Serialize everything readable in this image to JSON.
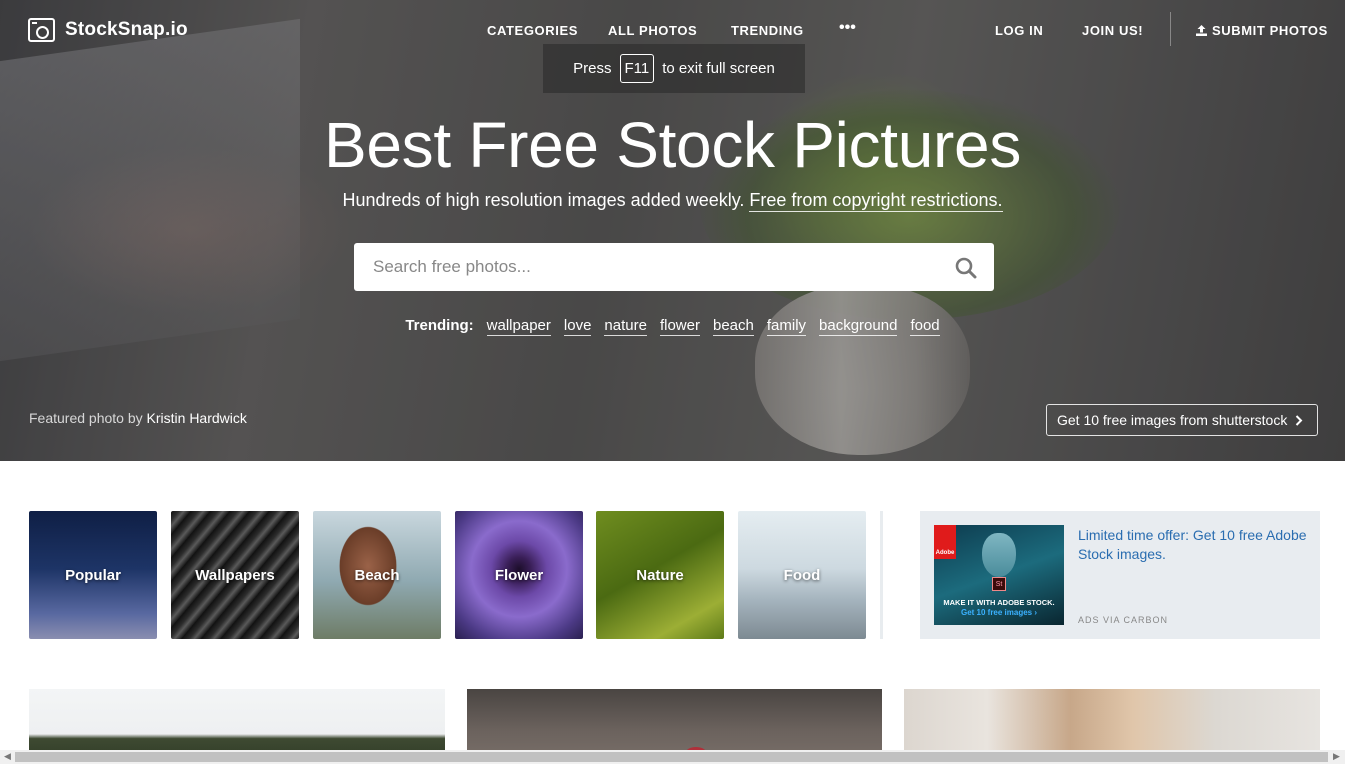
{
  "brand": {
    "name": "StockSnap.io"
  },
  "nav": {
    "categories": "CATEGORIES",
    "all_photos": "ALL PHOTOS",
    "trending": "TRENDING",
    "more": "•••",
    "log_in": "LOG IN",
    "join": "JOIN US!",
    "submit": "SUBMIT PHOTOS"
  },
  "fullscreen_notice": {
    "press": "Press",
    "key": "F11",
    "rest": "to exit full screen"
  },
  "hero": {
    "title": "Best Free Stock Pictures",
    "subtitle": "Hundreds of high resolution images added weekly.",
    "subtitle_link": "Free from copyright restrictions."
  },
  "search": {
    "placeholder": "Search free photos..."
  },
  "trending": {
    "label": "Trending:",
    "tags": [
      "wallpaper",
      "love",
      "nature",
      "flower",
      "beach",
      "family",
      "background",
      "food"
    ]
  },
  "featured": {
    "prefix": "Featured photo by",
    "author": "Kristin Hardwick"
  },
  "shutterstock_cta": "Get 10 free images from shutterstock",
  "categories": [
    "Popular",
    "Wallpapers",
    "Beach",
    "Flower",
    "Nature",
    "Food"
  ],
  "ad": {
    "brand": "Adobe",
    "badge": "St",
    "image_headline": "MAKE IT WITH ADOBE STOCK.",
    "image_cta": "Get 10 free images ›",
    "text": "Limited time offer: Get 10 free Adobe Stock images.",
    "via": "ADS VIA CARBON"
  },
  "colors": {
    "accent_link": "#2a6db0",
    "ad_bg": "#e8ecf0"
  }
}
